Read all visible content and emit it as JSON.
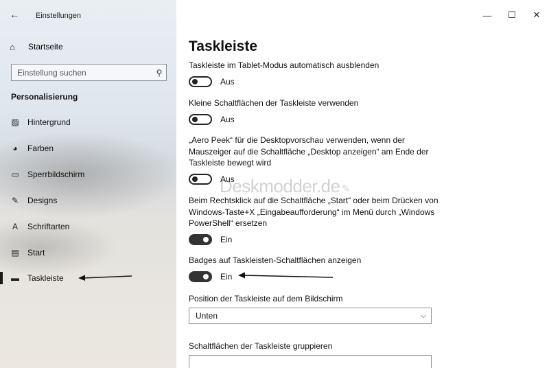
{
  "window": {
    "title": "Einstellungen",
    "back_glyph": "←",
    "controls": {
      "minimize": "—",
      "maximize": "☐",
      "close": "✕"
    }
  },
  "sidebar": {
    "home": {
      "label": "Startseite",
      "icon": "home-icon",
      "glyph": "⌂"
    },
    "search": {
      "placeholder": "Einstellung suchen",
      "icon": "search-icon",
      "glyph": "⚲"
    },
    "section_title": "Personalisierung",
    "items": [
      {
        "label": "Hintergrund",
        "icon": "background-image-icon",
        "glyph": "▨"
      },
      {
        "label": "Farben",
        "icon": "palette-icon",
        "glyph": "◕"
      },
      {
        "label": "Sperrbildschirm",
        "icon": "lock-screen-icon",
        "glyph": "▭"
      },
      {
        "label": "Designs",
        "icon": "themes-icon",
        "glyph": "✎"
      },
      {
        "label": "Schriftarten",
        "icon": "fonts-icon",
        "glyph": "A"
      },
      {
        "label": "Start",
        "icon": "start-icon",
        "glyph": "▤"
      },
      {
        "label": "Taskleiste",
        "icon": "taskbar-icon",
        "glyph": "▬",
        "active": true
      }
    ]
  },
  "main": {
    "page_title": "Taskleiste",
    "settings": [
      {
        "desc": "Taskleiste im Tablet-Modus automatisch ausblenden",
        "state": "Aus",
        "on": false
      },
      {
        "desc": "Kleine Schaltflächen der Taskleiste verwenden",
        "state": "Aus",
        "on": false
      },
      {
        "desc": "„Aero Peek“ für die Desktopvorschau verwenden, wenn der Mauszeiger auf die Schaltfläche „Desktop anzeigen“ am Ende der Taskleiste bewegt wird",
        "state": "Aus",
        "on": false
      },
      {
        "desc": "Beim Rechtsklick auf die Schaltfläche „Start“ oder beim Drücken von Windows-Taste+X „Eingabeaufforderung“ im Menü durch „Windows PowerShell“ ersetzen",
        "state": "Ein",
        "on": true
      },
      {
        "desc": "Badges auf Taskleisten-Schaltflächen anzeigen",
        "state": "Ein",
        "on": true
      }
    ],
    "position": {
      "label": "Position der Taskleiste auf dem Bildschirm",
      "value": "Unten"
    },
    "group": {
      "label": "Schaltflächen der Taskleiste gruppieren",
      "value": ""
    }
  },
  "watermark": "Deskmodder.de"
}
